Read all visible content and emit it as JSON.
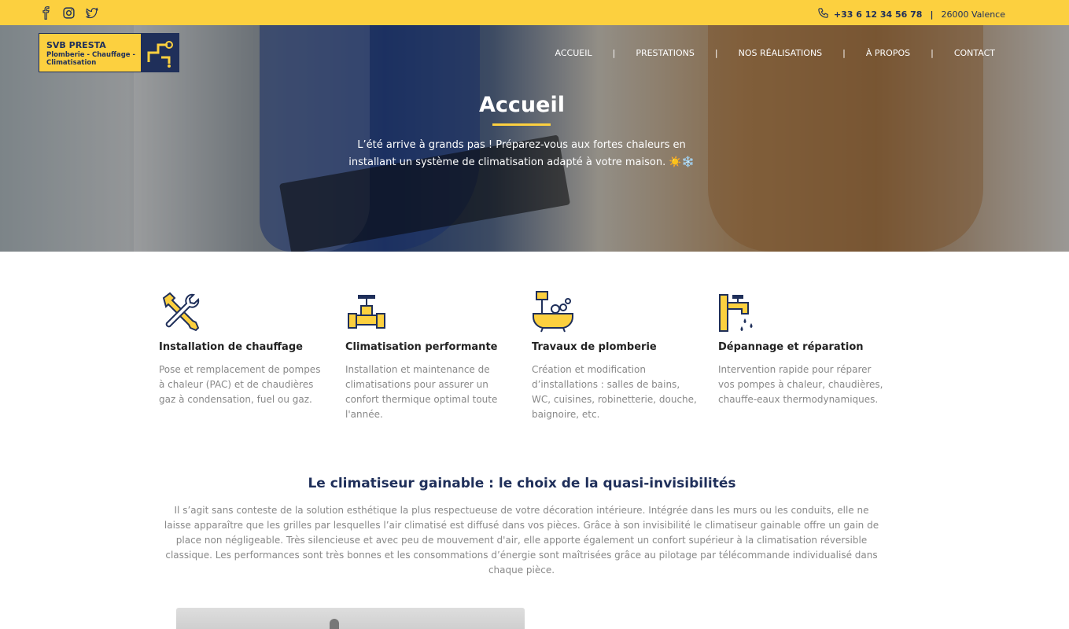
{
  "topbar": {
    "social": [
      "facebook-icon",
      "instagram-icon",
      "twitter-icon"
    ],
    "phone": "+33 6 12 34 56 78",
    "separator": "|",
    "city": "26000 Valence",
    "bg_color": "#fcd03f"
  },
  "logo": {
    "line1": "SVB PRESTA",
    "line2": "Plomberie - Chauffage -",
    "line3": "Climatisation"
  },
  "nav": {
    "items": [
      "ACCUEIL",
      "PRESTATIONS",
      "NOS RÉALISATIONS",
      "À PROPOS",
      "CONTACT"
    ],
    "divider": "|"
  },
  "hero": {
    "title": "Accueil",
    "text": "L’été arrive à grands pas ! Préparez-vous aux fortes chaleurs en installant un système de climatisation adapté à votre maison. ☀️❄️"
  },
  "features": [
    {
      "icon": "wrench-screwdriver-icon",
      "title": "Installation de chauffage",
      "text": "Pose et remplacement de pompes à chaleur (PAC) et de chaudières gaz à condensation, fuel ou gaz."
    },
    {
      "icon": "valve-pipe-icon",
      "title": "Climatisation performante",
      "text": "Installation et maintenance de climatisations pour assurer un confort thermique optimal toute l'année."
    },
    {
      "icon": "bathtub-icon",
      "title": "Travaux de plomberie",
      "text": "Création et modification d’installations : salles de bains, WC, cuisines, robinetterie, douche, baignoire, etc."
    },
    {
      "icon": "faucet-icon",
      "title": "Dépannage et réparation",
      "text": "Intervention rapide pour réparer vos pompes à chaleur, chaudières, chauffe-eaux thermodynamiques."
    }
  ],
  "section": {
    "title": "Le climatiseur gainable : le choix de la quasi-invisibilités",
    "text": "Il s’agit sans conteste de la solution esthétique la plus respectueuse de votre décoration intérieure. Intégrée dans les murs ou les conduits, elle ne laisse apparaître que les grilles par lesquelles l’air climatisé est diffusé dans vos pièces. Grâce à son invisibilité le climatiseur gainable offre un gain de place non négligeable. Très silencieuse et avec peu de mouvement d'air, elle apporte également un confort supérieur à la climatisation réversible classique. Les performances sont très bonnes et les consommations d’énergie sont maîtrisées grâce au pilotage par télécommande individualisé dans chaque pièce."
  },
  "colors": {
    "accent": "#fcd03f",
    "navy": "#1f2f5a",
    "muted_text": "#888888"
  }
}
